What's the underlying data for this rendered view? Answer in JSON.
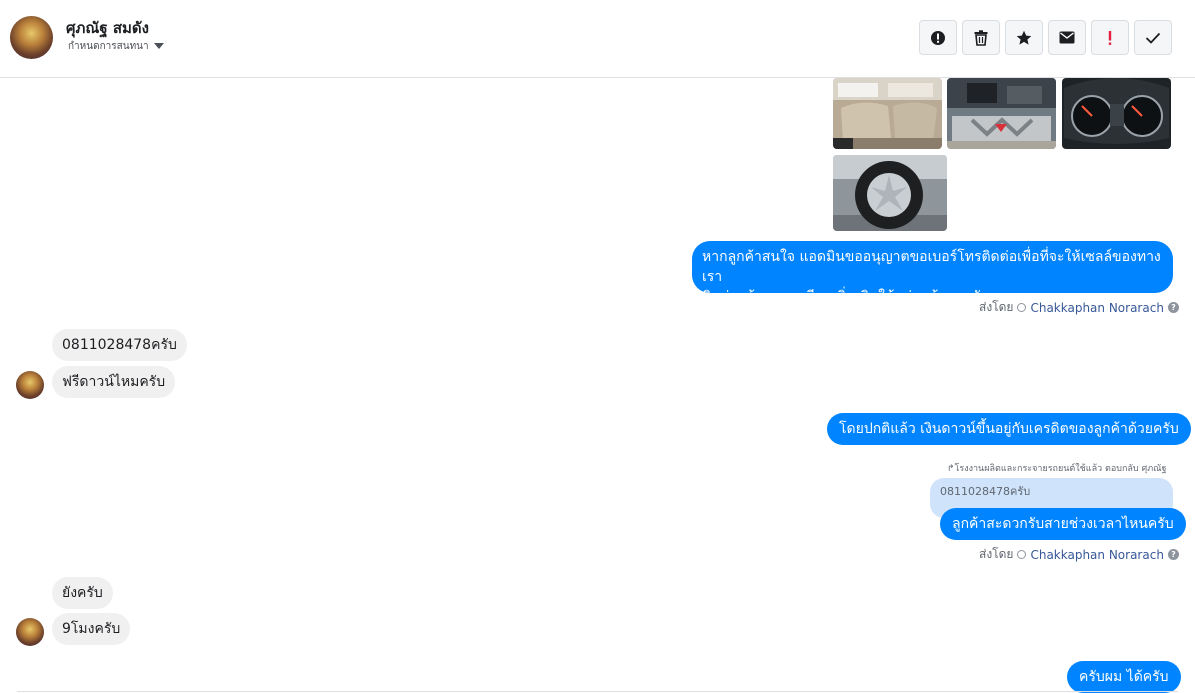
{
  "header": {
    "contact_name": "ศุภณัฐ สมดัง",
    "conversation_label": "กำหนดการสนทนา",
    "toolbar": [
      {
        "icon": "alert-circle-icon"
      },
      {
        "icon": "trash-icon"
      },
      {
        "icon": "star-icon"
      },
      {
        "icon": "envelope-icon"
      },
      {
        "icon": "exclamation-icon"
      },
      {
        "icon": "checkmark-icon"
      }
    ]
  },
  "messages": {
    "out_1_line1": "หากลูกค้าสนใจ แอดมินขออนุญาตขอเบอร์โทรติดต่อเพื่อที่จะให้เซลล์ของทางเรา",
    "out_1_line2": "ติดต่อแจ้งรายละเอียดเพิ่มเติมให้แก่ลูกค้านะครับ",
    "sent_by_prefix": "ส่งโดย",
    "agent_name": "Chakkaphan Norarach",
    "in_1": "0811028478ครับ",
    "in_2": "ฟรีดาวน์ไหมครับ",
    "out_2": "โดยปกติแล้ว เงินดาวน์ขึ้นอยู่กับเครดิตของลูกค้าด้วยครับ",
    "reply_meta": "โรงงานผลิตและกระจายรถยนต์ใช้แล้ว ตอบกลับ ศุภณัฐ",
    "quoted": "0811028478ครับ",
    "out_3": "ลูกค้าสะดวกรับสายช่วงเวลาไหนครับ",
    "in_3": "ยังครับ",
    "in_4": "9โมงครับ",
    "out_4": "ครับผม ได้ครับ"
  },
  "colors": {
    "outgoing_bubble": "#0084ff",
    "incoming_bubble": "#f1f0f0",
    "agent_link": "#385898",
    "quoted_bubble": "#cfe3fb"
  }
}
